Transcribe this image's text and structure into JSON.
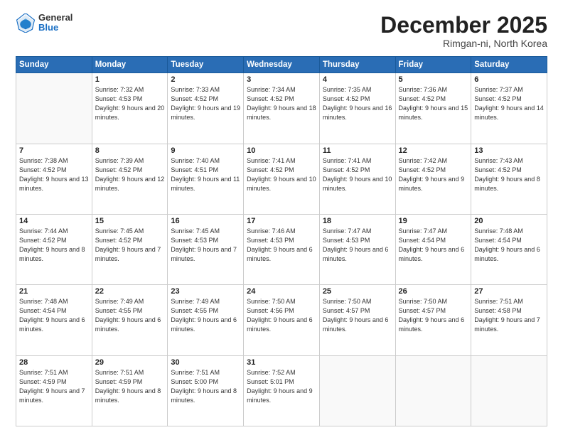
{
  "logo": {
    "general": "General",
    "blue": "Blue"
  },
  "title": "December 2025",
  "location": "Rimgan-ni, North Korea",
  "days_of_week": [
    "Sunday",
    "Monday",
    "Tuesday",
    "Wednesday",
    "Thursday",
    "Friday",
    "Saturday"
  ],
  "weeks": [
    [
      {
        "day": "",
        "empty": true
      },
      {
        "day": "1",
        "sunrise": "7:32 AM",
        "sunset": "4:53 PM",
        "daylight": "9 hours and 20 minutes."
      },
      {
        "day": "2",
        "sunrise": "7:33 AM",
        "sunset": "4:52 PM",
        "daylight": "9 hours and 19 minutes."
      },
      {
        "day": "3",
        "sunrise": "7:34 AM",
        "sunset": "4:52 PM",
        "daylight": "9 hours and 18 minutes."
      },
      {
        "day": "4",
        "sunrise": "7:35 AM",
        "sunset": "4:52 PM",
        "daylight": "9 hours and 16 minutes."
      },
      {
        "day": "5",
        "sunrise": "7:36 AM",
        "sunset": "4:52 PM",
        "daylight": "9 hours and 15 minutes."
      },
      {
        "day": "6",
        "sunrise": "7:37 AM",
        "sunset": "4:52 PM",
        "daylight": "9 hours and 14 minutes."
      }
    ],
    [
      {
        "day": "7",
        "sunrise": "7:38 AM",
        "sunset": "4:52 PM",
        "daylight": "9 hours and 13 minutes."
      },
      {
        "day": "8",
        "sunrise": "7:39 AM",
        "sunset": "4:52 PM",
        "daylight": "9 hours and 12 minutes."
      },
      {
        "day": "9",
        "sunrise": "7:40 AM",
        "sunset": "4:51 PM",
        "daylight": "9 hours and 11 minutes."
      },
      {
        "day": "10",
        "sunrise": "7:41 AM",
        "sunset": "4:52 PM",
        "daylight": "9 hours and 10 minutes."
      },
      {
        "day": "11",
        "sunrise": "7:41 AM",
        "sunset": "4:52 PM",
        "daylight": "9 hours and 10 minutes."
      },
      {
        "day": "12",
        "sunrise": "7:42 AM",
        "sunset": "4:52 PM",
        "daylight": "9 hours and 9 minutes."
      },
      {
        "day": "13",
        "sunrise": "7:43 AM",
        "sunset": "4:52 PM",
        "daylight": "9 hours and 8 minutes."
      }
    ],
    [
      {
        "day": "14",
        "sunrise": "7:44 AM",
        "sunset": "4:52 PM",
        "daylight": "9 hours and 8 minutes."
      },
      {
        "day": "15",
        "sunrise": "7:45 AM",
        "sunset": "4:52 PM",
        "daylight": "9 hours and 7 minutes."
      },
      {
        "day": "16",
        "sunrise": "7:45 AM",
        "sunset": "4:53 PM",
        "daylight": "9 hours and 7 minutes."
      },
      {
        "day": "17",
        "sunrise": "7:46 AM",
        "sunset": "4:53 PM",
        "daylight": "9 hours and 6 minutes."
      },
      {
        "day": "18",
        "sunrise": "7:47 AM",
        "sunset": "4:53 PM",
        "daylight": "9 hours and 6 minutes."
      },
      {
        "day": "19",
        "sunrise": "7:47 AM",
        "sunset": "4:54 PM",
        "daylight": "9 hours and 6 minutes."
      },
      {
        "day": "20",
        "sunrise": "7:48 AM",
        "sunset": "4:54 PM",
        "daylight": "9 hours and 6 minutes."
      }
    ],
    [
      {
        "day": "21",
        "sunrise": "7:48 AM",
        "sunset": "4:54 PM",
        "daylight": "9 hours and 6 minutes."
      },
      {
        "day": "22",
        "sunrise": "7:49 AM",
        "sunset": "4:55 PM",
        "daylight": "9 hours and 6 minutes."
      },
      {
        "day": "23",
        "sunrise": "7:49 AM",
        "sunset": "4:55 PM",
        "daylight": "9 hours and 6 minutes."
      },
      {
        "day": "24",
        "sunrise": "7:50 AM",
        "sunset": "4:56 PM",
        "daylight": "9 hours and 6 minutes."
      },
      {
        "day": "25",
        "sunrise": "7:50 AM",
        "sunset": "4:57 PM",
        "daylight": "9 hours and 6 minutes."
      },
      {
        "day": "26",
        "sunrise": "7:50 AM",
        "sunset": "4:57 PM",
        "daylight": "9 hours and 6 minutes."
      },
      {
        "day": "27",
        "sunrise": "7:51 AM",
        "sunset": "4:58 PM",
        "daylight": "9 hours and 7 minutes."
      }
    ],
    [
      {
        "day": "28",
        "sunrise": "7:51 AM",
        "sunset": "4:59 PM",
        "daylight": "9 hours and 7 minutes."
      },
      {
        "day": "29",
        "sunrise": "7:51 AM",
        "sunset": "4:59 PM",
        "daylight": "9 hours and 8 minutes."
      },
      {
        "day": "30",
        "sunrise": "7:51 AM",
        "sunset": "5:00 PM",
        "daylight": "9 hours and 8 minutes."
      },
      {
        "day": "31",
        "sunrise": "7:52 AM",
        "sunset": "5:01 PM",
        "daylight": "9 hours and 9 minutes."
      },
      {
        "day": "",
        "empty": true
      },
      {
        "day": "",
        "empty": true
      },
      {
        "day": "",
        "empty": true
      }
    ]
  ]
}
